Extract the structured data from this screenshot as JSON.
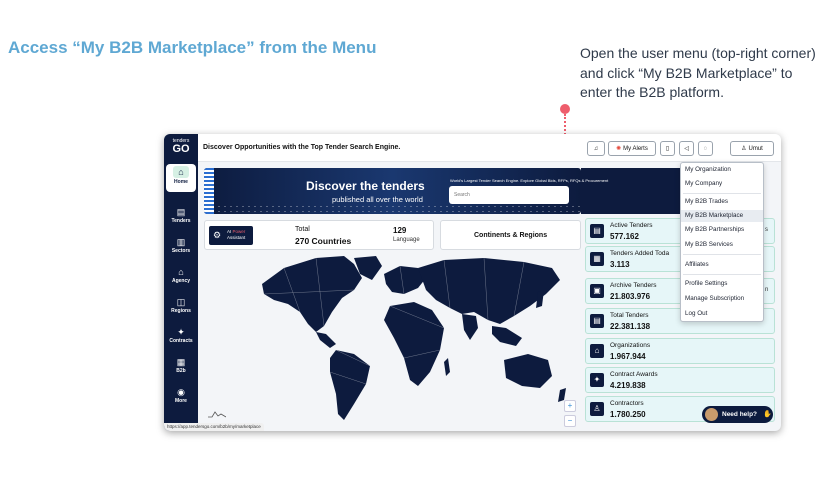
{
  "guide": {
    "title": "Access “My B2B Marketplace” from the Menu",
    "caption": "Open the user menu (top-right corner) and click “My B2B Marketplace” to enter the B2B platform."
  },
  "app": {
    "logo_top": "tenders",
    "logo_main": "GO",
    "headline": "Discover Opportunities with the Top Tender Search Engine.",
    "toolbar": {
      "alerts_label": "My Alerts",
      "user_label": "Umut"
    },
    "sidebar": {
      "items": [
        {
          "label": "Home",
          "icon": "home-icon"
        },
        {
          "label": "Tenders",
          "icon": "document-icon"
        },
        {
          "label": "Sectors",
          "icon": "bar-chart-icon"
        },
        {
          "label": "Agency",
          "icon": "building-icon"
        },
        {
          "label": "Regions",
          "icon": "map-icon"
        },
        {
          "label": "Contracts",
          "icon": "contract-icon"
        },
        {
          "label": "B2b",
          "icon": "b2b-icon"
        },
        {
          "label": "More",
          "icon": "more-icon"
        }
      ]
    },
    "hero": {
      "title": "Discover the tenders",
      "subtitle": "published all over the world",
      "tagline": "World's Largest Tender Search Engine. Explore Global Bids, RFPs, RFQs & Procurement",
      "search_placeholder": "Search"
    },
    "stats": {
      "ai_line1": "AI",
      "ai_line1_accent": "Power",
      "ai_line2": "Assistant",
      "total_label": "Total",
      "total_value": "270 Countries",
      "language_value": "129",
      "language_label": "Language",
      "continents_label": "Continents & Regions"
    },
    "kpis": [
      {
        "label": "Active Tenders",
        "value": "577.162",
        "side": "s"
      },
      {
        "label": "Tenders Added Toda",
        "value": "3.113",
        "side": ""
      },
      {
        "label": "Archive Tenders",
        "value": "21.803.976",
        "side": "n"
      },
      {
        "label": "Total Tenders",
        "value": "22.381.138",
        "side": ""
      },
      {
        "label": "Organizations",
        "value": "1.967.944",
        "side": ""
      },
      {
        "label": "Contract Awards",
        "value": "4.219.838",
        "side": ""
      },
      {
        "label": "Contractors",
        "value": "1.780.250",
        "side": ""
      }
    ],
    "user_menu": {
      "items": [
        "My Organization",
        "My Company",
        "My B2B Trades",
        "My B2B Marketplace",
        "My B2B Partnerships",
        "My B2B Services",
        "Affiliates",
        "Profile Settings",
        "Manage Subscription",
        "Log Out"
      ],
      "highlighted": "My B2B Marketplace"
    },
    "help_label": "Need help?",
    "zoom_in": "+",
    "zoom_out": "−",
    "status_url": "https://app.tendersgo.com/b2b/my/marketplace"
  },
  "colors": {
    "navy": "#0d1b3e",
    "accent_blue": "#5fa8d3",
    "guide_red": "#ee5d6c",
    "kpi_bg": "#e6f6f8"
  }
}
